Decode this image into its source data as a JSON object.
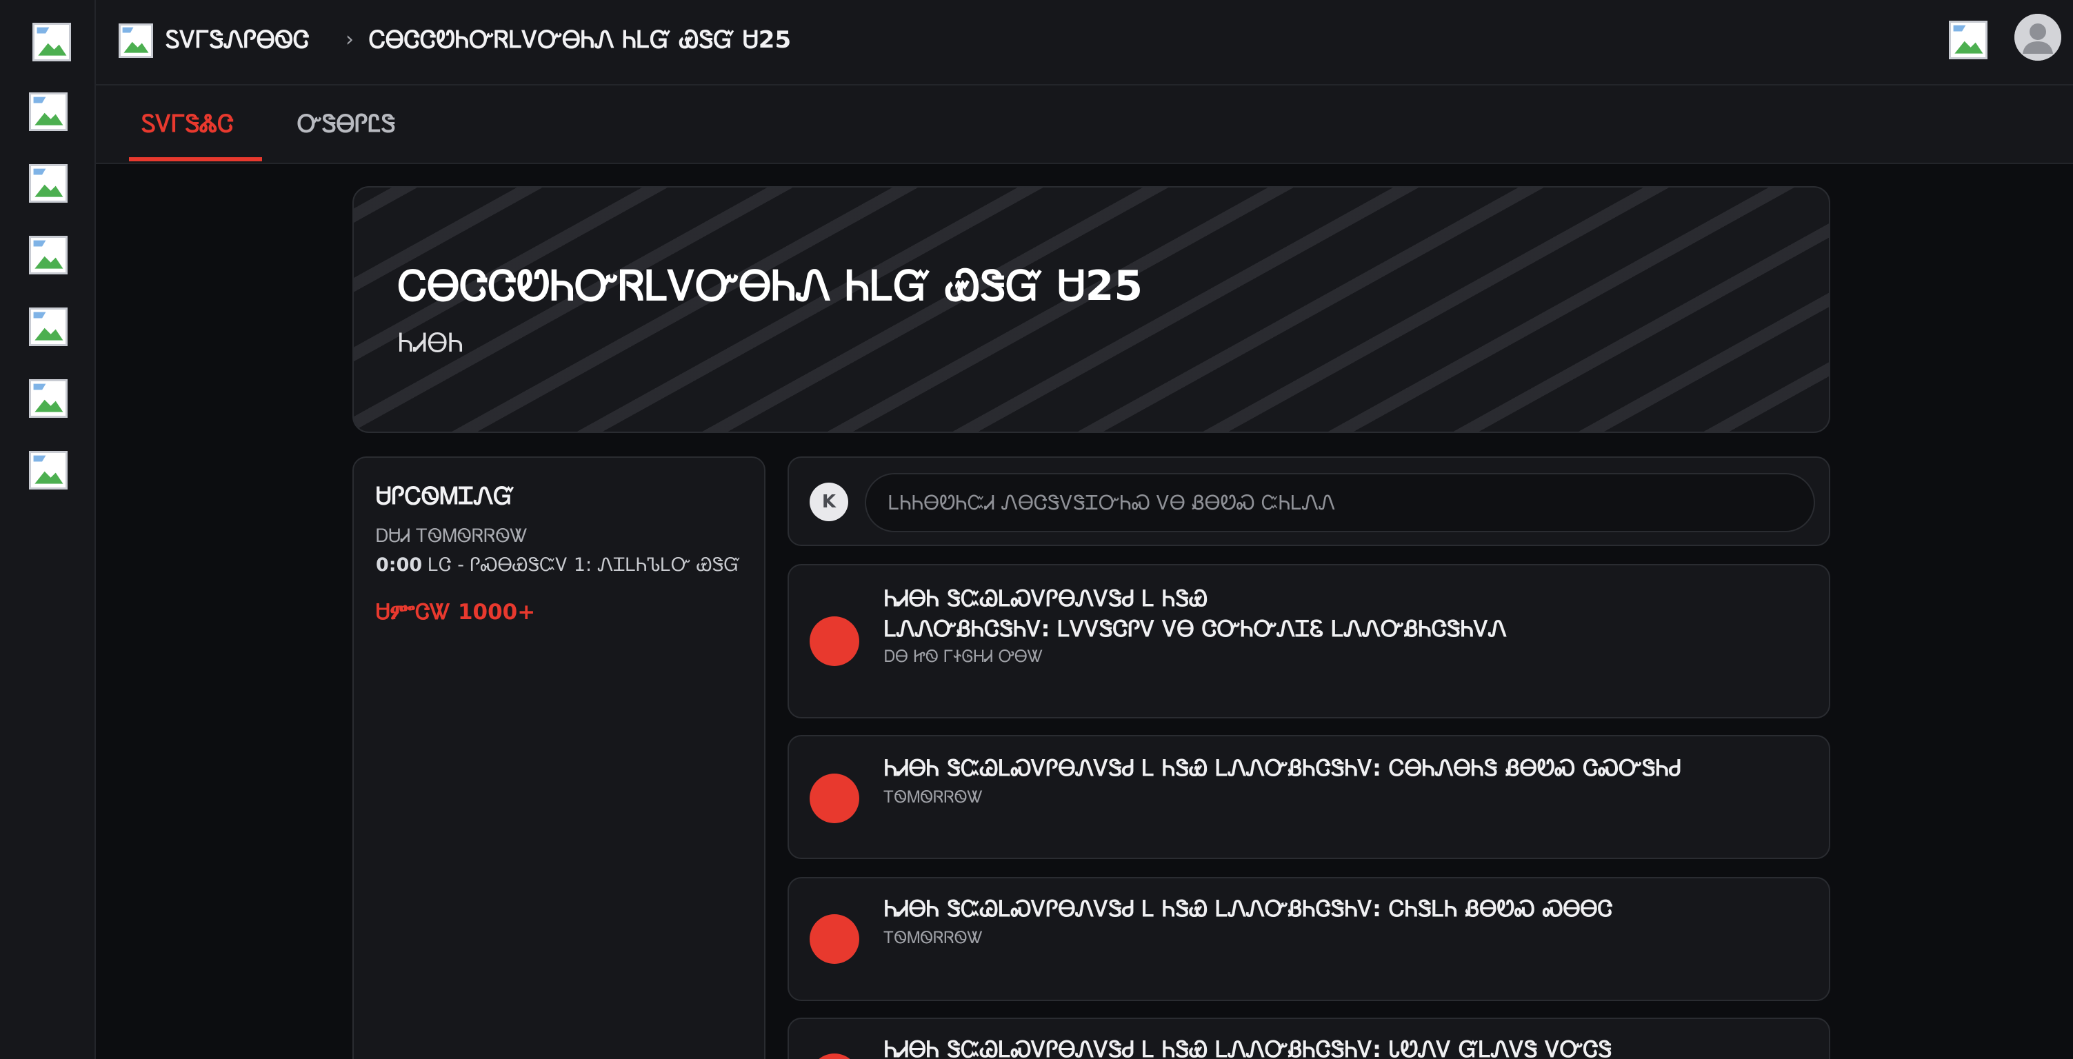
{
  "topbar": {
    "crumb_root": "ᏚᏙᎱᏕᏁᎵᎾᏫᏣ",
    "crumb_sep": "›",
    "crumb_current": "ᏟᎾᏣᏣᏬᏂᏅᏒᏞᏙᏅᎾᏂᏁ ᏂᏞᏳ ᏯᏕᏳ Ꮜ25"
  },
  "tabs": [
    {
      "label": "ᏚᏙᎱᏕᏜᏣ",
      "active": true
    },
    {
      "label": "ᏅᏕᎾᎵᏝᏕ",
      "active": false
    }
  ],
  "hero": {
    "title": "ᏟᎾᏣᏣᏬᏂᏅᏒᏞᏙᏅᎾᏂᏁ ᏂᏞᏳ ᏯᏕᏳ Ꮜ25",
    "subtitle": "ᏂᏗᎾᏂ"
  },
  "upcoming": {
    "title": "ᏌᎵᏟᏫᎷᏆᏁᏳ",
    "line1": "ᎠᏌᏗ ᎢᏫᎷᏫᏒᏒᏫᏔ",
    "line2_prefix": "0:00",
    "line2_rest": " ᏞᏣ - ᎵᏍᎾᏯᏕᏨᏙ 1: ᏁᏆᏞᏂᏖᏞᏅ ᏯᏕᏳ",
    "view_link": "ᏌᎃᏣᏔ 1000+"
  },
  "composer": {
    "avatar_letter": "K",
    "placeholder": "ᏞᏂᏂᎾᏬᏂᏨᏗ ᏁᎾᏣᏕᏙᏕᏆᏅᏂᏍ ᏙᎾ ᏰᎾᏬᏍ ᏨᏂᏞᏁᏁ"
  },
  "feed": [
    {
      "title": "ᏂᏗᎾᏂ ᏕᏨᏊᏞᏍᏙᎵᎾᏁᏙᏕᏧ Ꮮ ᏂᏕᏯ\nᏞᏁᏁᏅᏰᏂᏣᏕᏂᏙ: ᏞᏙᏙᏕᏣᎵᏙ ᏙᎾ ᏣᏅᏂᏅᏁᏆᏋ ᏞᏁᏁᏅᏰᏂᏣᏕᏂᏙᏁ",
      "meta": "ᎠᎾ ᏥᏫ ᎱᏐᎶᎻᏗ ᎤᎾᏔ"
    },
    {
      "title": "ᏂᏗᎾᏂ ᏕᏨᏊᏞᏍᏙᎵᎾᏁᏙᏕᏧ Ꮮ ᏂᏕᏯ ᏞᏁᏁᏅᏰᏂᏣᏕᏂᏙ: ᏟᎾᏂᏁᎾᏂᏕ ᏰᎾᏬᏍ ᏣᏍᏅᏕᏂᏧ",
      "meta": "ᎢᏫᎷᏫᏒᏒᏫᏔ"
    },
    {
      "title": "ᏂᏗᎾᏂ ᏕᏨᏊᏞᏍᏙᎵᎾᏁᏙᏕᏧ Ꮮ ᏂᏕᏯ ᏞᏁᏁᏅᏰᏂᏣᏕᏂᏙ: ᏟᏂᏕᏞᏂ ᏰᎾᏬᏍ ᏍᎾᎾᏣ",
      "meta": "ᎢᏫᎷᏫᏒᏒᏫᏔ"
    },
    {
      "title": "ᏂᏗᎾᏂ ᏕᏨᏊᏞᏍᏙᎵᎾᏁᏙᏕᏧ Ꮮ ᏂᏕᏯ ᏞᏁᏁᏅᏰᏂᏣᏕᏂᏙ: ᏓᏬᏁᏙ ᏳᏞᏁᏙᏕ ᏙᏅᏣᏕ",
      "meta": ""
    }
  ],
  "colors": {
    "accent": "#e8392e",
    "background": "#0c0d10",
    "panel": "#16171b"
  }
}
